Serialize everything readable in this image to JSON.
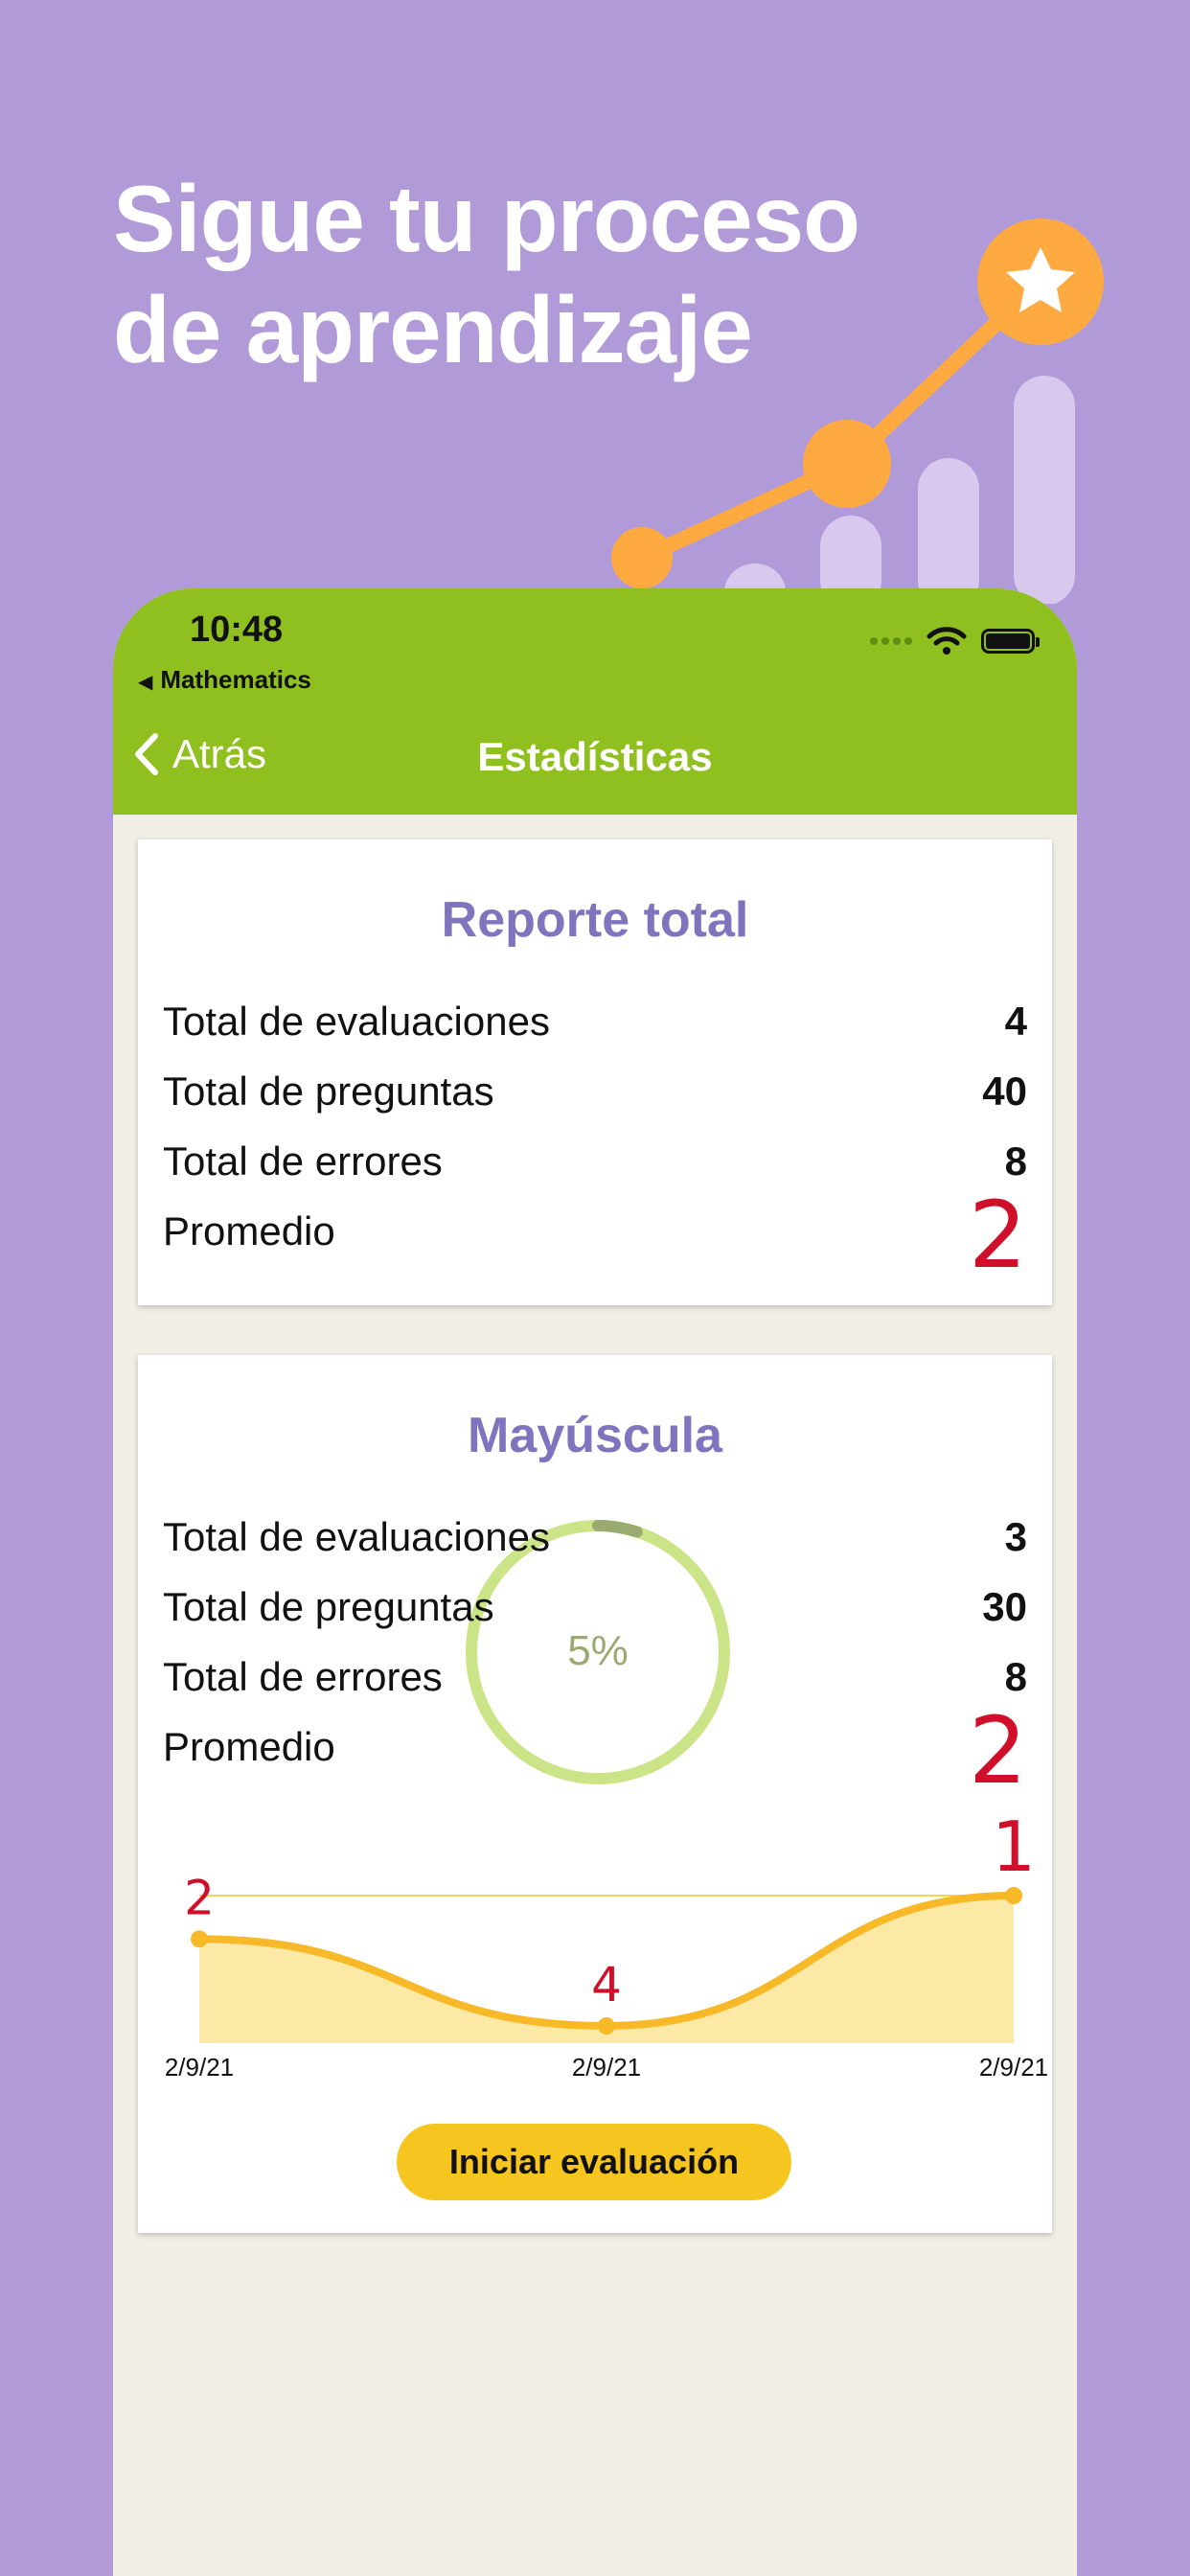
{
  "headline": {
    "line1": "Sigue tu proceso",
    "line2": "de aprendizaje"
  },
  "status_bar": {
    "time": "10:48",
    "back_app": "Mathematics"
  },
  "nav": {
    "back_label": "Atrás",
    "title": "Estadísticas"
  },
  "colors": {
    "background": "#b09ad8",
    "navbar": "#90c020",
    "title_purple": "#7f74bd",
    "accent_orange": "#ffaa40",
    "chart_yellow": "#f7c520",
    "average_red": "#d0102a"
  },
  "total_report": {
    "title": "Reporte total",
    "rows": [
      {
        "label": "Total de evaluaciones",
        "value": "4"
      },
      {
        "label": "Total de preguntas",
        "value": "40"
      },
      {
        "label": "Total de errores",
        "value": "8"
      },
      {
        "label": "Promedio",
        "value": "2"
      }
    ]
  },
  "mayuscula": {
    "title": "Mayúscula",
    "rows": [
      {
        "label": "Total de evaluaciones",
        "value": "3"
      },
      {
        "label": "Total de preguntas",
        "value": "30"
      },
      {
        "label": "Total de errores",
        "value": "8"
      },
      {
        "label": "Promedio",
        "value": "2"
      }
    ],
    "progress": {
      "label": "5%",
      "fraction": 0.05
    },
    "start_button": "Iniciar evaluación"
  },
  "chart_data": {
    "type": "area",
    "x": [
      "2/9/21",
      "2/9/21",
      "2/9/21"
    ],
    "values": [
      2,
      4,
      1
    ],
    "value_labels": [
      "2",
      "4",
      "1"
    ],
    "y_inverted": true,
    "ylim": [
      1,
      4
    ],
    "grid": false
  }
}
